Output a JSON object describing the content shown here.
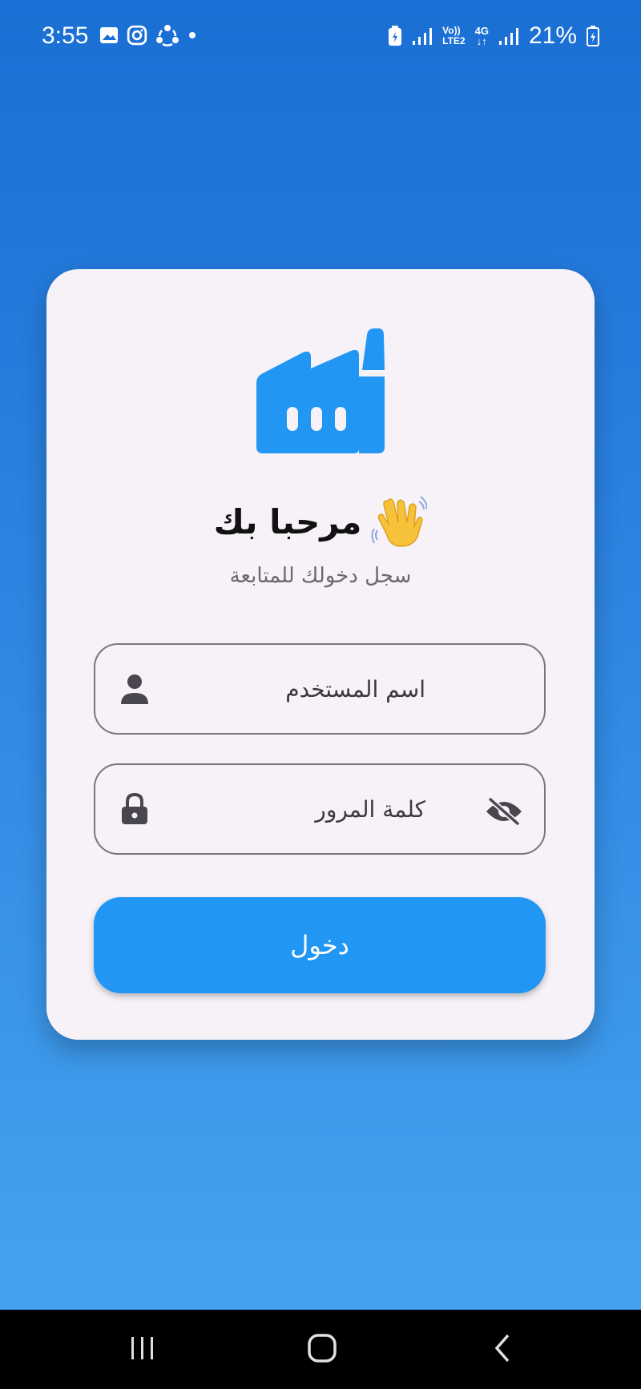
{
  "status_bar": {
    "time": "3:55",
    "battery_percent": "21%",
    "network_lte_top": "Vo))",
    "network_lte_bottom": "LTE2",
    "network_4g": "4G",
    "left_icons": [
      "gallery-icon",
      "instagram-icon",
      "share-icon",
      "dot-icon"
    ],
    "right_icons": [
      "battery-saver-icon",
      "signal-icon",
      "signal-icon",
      "battery-icon"
    ]
  },
  "login": {
    "logo_icon": "factory-icon",
    "logo_color": "#2196f3",
    "title": "مرحبا بك",
    "title_emoji": "waving-hand-icon",
    "subtitle": "سجل دخولك للمتابعة",
    "username": {
      "placeholder": "اسم المستخدم",
      "value": "",
      "icon": "person-icon"
    },
    "password": {
      "placeholder": "كلمة المرور",
      "value": "",
      "icon": "lock-icon",
      "toggle_icon": "eye-off-icon"
    },
    "submit_label": "دخول",
    "accent": "#2196f3"
  },
  "nav_bar": {
    "buttons": [
      "recent-apps-icon",
      "home-icon",
      "back-icon"
    ]
  }
}
